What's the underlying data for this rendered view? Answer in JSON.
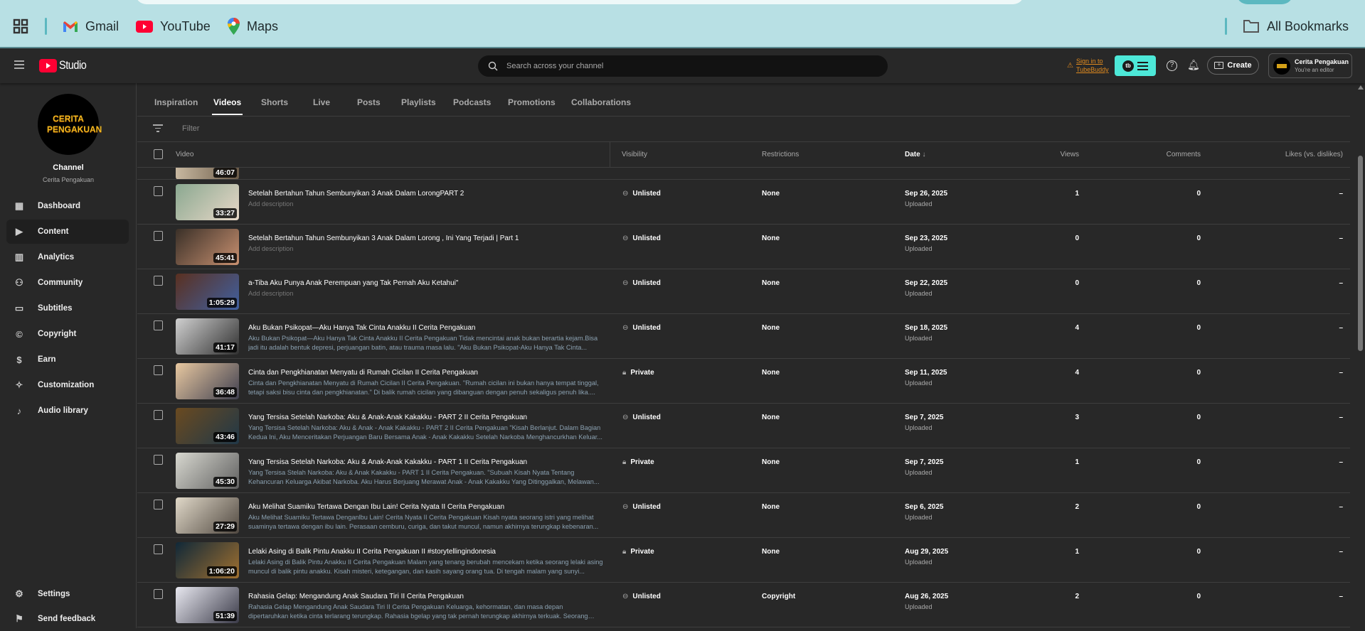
{
  "bookmarks": {
    "items": [
      {
        "label": "Gmail"
      },
      {
        "label": "YouTube"
      },
      {
        "label": "Maps"
      }
    ],
    "all": "All Bookmarks"
  },
  "header": {
    "logo": "Studio",
    "search_placeholder": "Search across your channel",
    "tubebuddy_signin": "Sign in to TubeBuddy",
    "tb_badge": "tb",
    "create": "Create",
    "account_name": "Cerita Pengakuan",
    "account_role": "You're an editor"
  },
  "sidebar": {
    "avatar_text": "CERITA PENGAKUAN",
    "channel_label": "Channel",
    "channel_name": "Cerita Pengakuan",
    "items": [
      {
        "label": "Dashboard",
        "icon": "dashboard-icon",
        "glyph": "▦"
      },
      {
        "label": "Content",
        "icon": "content-icon",
        "glyph": "▶"
      },
      {
        "label": "Analytics",
        "icon": "analytics-icon",
        "glyph": "▥"
      },
      {
        "label": "Community",
        "icon": "community-icon",
        "glyph": "⚇"
      },
      {
        "label": "Subtitles",
        "icon": "subtitles-icon",
        "glyph": "▭"
      },
      {
        "label": "Copyright",
        "icon": "copyright-icon",
        "glyph": "©"
      },
      {
        "label": "Earn",
        "icon": "earn-icon",
        "glyph": "$"
      },
      {
        "label": "Customization",
        "icon": "customization-icon",
        "glyph": "✧"
      },
      {
        "label": "Audio library",
        "icon": "audio-library-icon",
        "glyph": "♪"
      }
    ],
    "settings": "Settings",
    "feedback": "Send feedback"
  },
  "tabs": [
    "Inspiration",
    "Videos",
    "Shorts",
    "Live",
    "Posts",
    "Playlists",
    "Podcasts",
    "Promotions",
    "Collaborations"
  ],
  "filter_placeholder": "Filter",
  "columns": {
    "video": "Video",
    "visibility": "Visibility",
    "restrictions": "Restrictions",
    "date": "Date",
    "views": "Views",
    "comments": "Comments",
    "likes": "Likes (vs. dislikes)"
  },
  "partial_row_duration": "46:07",
  "videos": [
    {
      "title": "Setelah Bertahun Tahun Sembunyikan 3 Anak Dalam LorongPART 2",
      "description": "Add description",
      "duration": "33:27",
      "visibility": "Unlisted",
      "restrictions": "None",
      "date": "Sep 26, 2025",
      "status": "Uploaded",
      "views": "1",
      "comments": "0",
      "likes": "–",
      "thumb": [
        "#8aa890",
        "#e8d8c8"
      ]
    },
    {
      "title": "Setelah Bertahun Tahun Sembunyikan 3 Anak Dalam Lorong , Ini Yang Terjadi | Part 1",
      "description": "Add description",
      "duration": "45:41",
      "visibility": "Unlisted",
      "restrictions": "None",
      "date": "Sep 23, 2025",
      "status": "Uploaded",
      "views": "0",
      "comments": "0",
      "likes": "–",
      "thumb": [
        "#3a3028",
        "#c89070"
      ]
    },
    {
      "title": "a-Tiba Aku Punya Anak Perempuan yang Tak Pernah Aku Ketahui\"",
      "description": "Add description",
      "duration": "1:05:29",
      "visibility": "Unlisted",
      "restrictions": "None",
      "date": "Sep 22, 2025",
      "status": "Uploaded",
      "views": "0",
      "comments": "0",
      "likes": "–",
      "thumb": [
        "#5a3020",
        "#4060a0"
      ]
    },
    {
      "title": "Aku Bukan Psikopat—Aku Hanya Tak Cinta Anakku II Cerita Pengakuan",
      "description": "Aku Bukan Psikopat—Aku Hanya Tak Cinta Anakku II Cerita Pengakuan Tidak mencintai anak bukan berartia kejam.Bisa jadi itu adalah bentuk depresi, perjuangan batin, atau trauma masa lalu. \"Aku Bukan Psikopat-Aku Hanya Tak Cinta...",
      "duration": "41:17",
      "visibility": "Unlisted",
      "restrictions": "None",
      "date": "Sep 18, 2025",
      "status": "Uploaded",
      "views": "4",
      "comments": "0",
      "likes": "–",
      "thumb": [
        "#d0d0d0",
        "#303030"
      ]
    },
    {
      "title": "Cinta dan Pengkhianatan Menyatu di Rumah Cicilan II Cerita Pengakuan",
      "description": "Cinta dan Pengkhianatan Menyatu di Rumah Cicilan II Cerita Pengakuan. \"Rumah cicilan ini bukan hanya tempat tinggal, tetapi saksi bisu cinta dan pengkhianatan.\" Di balik rumah cicilan yang dibanguan dengan penuh sekaligus penuh lika....",
      "duration": "36:48",
      "visibility": "Private",
      "restrictions": "None",
      "date": "Sep 11, 2025",
      "status": "Uploaded",
      "views": "4",
      "comments": "0",
      "likes": "–",
      "thumb": [
        "#e8c8a0",
        "#404050"
      ]
    },
    {
      "title": "Yang Tersisa Setelah Narkoba: Aku & Anak-Anak Kakakku - PART 2 II Cerita Pengakuan",
      "description": "Yang Tersisa Setelah Narkoba: Aku & Anak - Anak Kakakku - PART 2 II Cerita Pengakuan \"Kisah Berlanjut. Dalam Bagian Kedua Ini, Aku Menceritakan Perjuangan Baru Bersama Anak - Anak Kakakku Setelah Narkoba Menghancurkhan Keluar...",
      "duration": "43:46",
      "visibility": "Unlisted",
      "restrictions": "None",
      "date": "Sep 7, 2025",
      "status": "Uploaded",
      "views": "3",
      "comments": "0",
      "likes": "–",
      "thumb": [
        "#6a4a20",
        "#203848"
      ]
    },
    {
      "title": "Yang Tersisa Setelah Narkoba: Aku & Anak-Anak Kakakku - PART 1 II Cerita Pengakuan",
      "description": "Yang Tersisa Stelah Narkoba: Aku & Anak Kakakku - PART 1 II Cerita Pengakuan. \"Subuah Kisah Nyata Tentang Kehancuran Keluarga Akibat Narkoba. Aku Harus Berjuang Merawat Anak - Anak Kakakku Yang Ditinggalkan, Melawan...",
      "duration": "45:30",
      "visibility": "Private",
      "restrictions": "None",
      "date": "Sep 7, 2025",
      "status": "Uploaded",
      "views": "1",
      "comments": "0",
      "likes": "–",
      "thumb": [
        "#d8d8d0",
        "#606060"
      ]
    },
    {
      "title": "Aku Melihat Suamiku Tertawa Dengan Ibu Lain! Cerita Nyata II Cerita Pengakuan",
      "description": "Aku Melihat Suamiku Tertawa Denganlbu Lain! Cerita Nyata II Cerita Pengakuan Kisah nyata seorang istri yang melihat suaminya tertawa dengan ibu lain. Perasaan cemburu, curiga, dan takut muncul, namun akhirnya terungkap kebenaran...",
      "duration": "27:29",
      "visibility": "Unlisted",
      "restrictions": "None",
      "date": "Sep 6, 2025",
      "status": "Uploaded",
      "views": "2",
      "comments": "0",
      "likes": "–",
      "thumb": [
        "#e0d8c8",
        "#504840"
      ]
    },
    {
      "title": "Lelaki Asing di Balik Pintu Anakku II Cerita Pengakuan II #storytellingindonesia",
      "description": "Lelaki Asing di Balik Pintu Anakku II Cerita Pengakuan Malam yang tenang berubah mencekam ketika seorang lelaki asing muncul di balik pintu anakku. Kisah misteri, ketegangan, dan kasih sayang orang tua. Di tengah malam yang sunyi...",
      "duration": "1:06:20",
      "visibility": "Private",
      "restrictions": "None",
      "date": "Aug 29, 2025",
      "status": "Uploaded",
      "views": "1",
      "comments": "0",
      "likes": "–",
      "thumb": [
        "#102838",
        "#a07030"
      ]
    },
    {
      "title": "Rahasia Gelap: Mengandung Anak Saudara Tiri II Cerita Pengakuan",
      "description": "Rahasia Gelap Mengandung Anak Saudara Tiri II Cerita Pengakuan Keluarga, kehormatan, dan masa depan dipertaruhkan ketika cinta terlarang terungkap. Rahasia bgelap yang tak pernah terungkap akhirnya terkuak. Seorang gadis terjebak...",
      "duration": "51:39",
      "visibility": "Unlisted",
      "restrictions": "Copyright",
      "date": "Aug 26, 2025",
      "status": "Uploaded",
      "views": "2",
      "comments": "0",
      "likes": "–",
      "thumb": [
        "#e8e8f0",
        "#3a3a48"
      ]
    }
  ],
  "colors": {
    "bg": "#282828",
    "bookmarks_bg": "#b8e0e4",
    "tubebuddy": "#4de8d8",
    "link_orange": "#e08a1e",
    "yt_red": "#ff0033"
  }
}
